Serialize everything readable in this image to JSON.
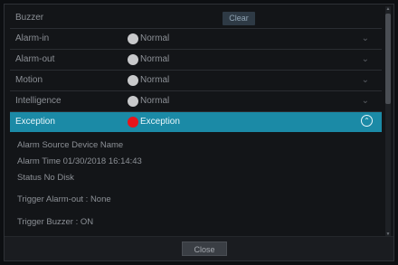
{
  "header": {
    "title": "Buzzer",
    "clear_label": "Clear"
  },
  "alarms": [
    {
      "name": "Alarm-in",
      "status": "Normal",
      "dot_color": "#c8c9cb"
    },
    {
      "name": "Alarm-out",
      "status": "Normal",
      "dot_color": "#c8c9cb"
    },
    {
      "name": "Motion",
      "status": "Normal",
      "dot_color": "#c8c9cb"
    },
    {
      "name": "Intelligence",
      "status": "Normal",
      "dot_color": "#c8c9cb"
    },
    {
      "name": "Exception",
      "status": "Exception",
      "dot_color": "#e8141b",
      "selected": true
    }
  ],
  "details": {
    "alarm_source": "Alarm Source    Device Name",
    "alarm_time": "Alarm Time    01/30/2018 16:14:43",
    "status": "Status    No Disk",
    "trigger_alarm_out": "Trigger Alarm-out    : None",
    "trigger_buzzer": "Trigger Buzzer    : ON"
  },
  "footer": {
    "close_label": "Close"
  },
  "colors": {
    "accent": "#1b8aa6",
    "exception": "#e8141b"
  }
}
